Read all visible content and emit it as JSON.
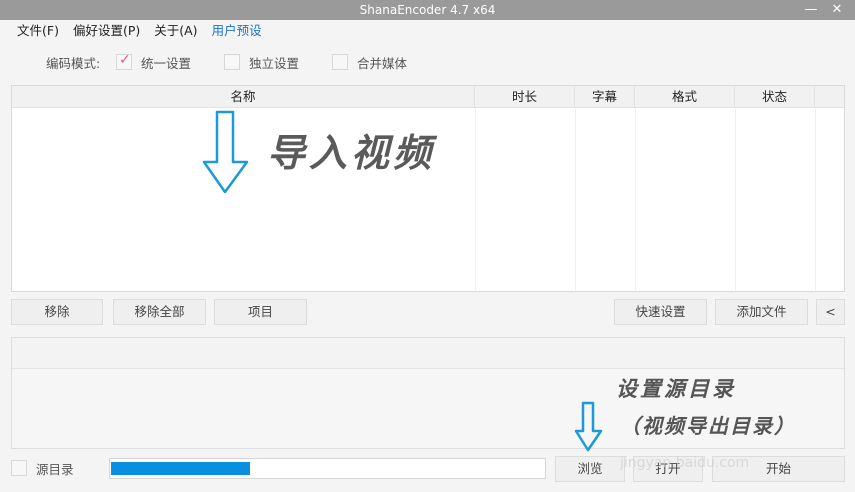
{
  "window": {
    "title": "ShanaEncoder 4.7 x64",
    "minimize": "—",
    "close": "✕"
  },
  "menu": {
    "items": [
      {
        "label": "文件(F)"
      },
      {
        "label": "偏好设置(P)"
      },
      {
        "label": "关于(A)"
      },
      {
        "label": "用户预设"
      }
    ],
    "accent": "#1c6fd1"
  },
  "mode": {
    "label": "编码模式:",
    "options": [
      {
        "label": "统一设置",
        "checked": true
      },
      {
        "label": "独立设置",
        "checked": false
      },
      {
        "label": "合并媒体",
        "checked": false
      }
    ]
  },
  "table": {
    "columns": [
      "名称",
      "时长",
      "字幕",
      "格式",
      "状态"
    ],
    "rows": []
  },
  "buttons": {
    "remove": "移除",
    "remove_all": "移除全部",
    "item": "项目",
    "quick_settings": "快速设置",
    "add_file": "添加文件",
    "collapse": "<",
    "browse": "浏览",
    "open": "打开",
    "start": "开始"
  },
  "output": {
    "source_dir_label": "源目录",
    "progress_fraction": 0.32,
    "progress_color": "#0a8fe0"
  },
  "annotations": {
    "import_video": "导入视频",
    "set_source_line1": "设置源目录",
    "set_source_line2": "（视频导出目录）",
    "arrow_color": "#1a9ad6"
  },
  "watermark": "jingyan.baidu.com"
}
